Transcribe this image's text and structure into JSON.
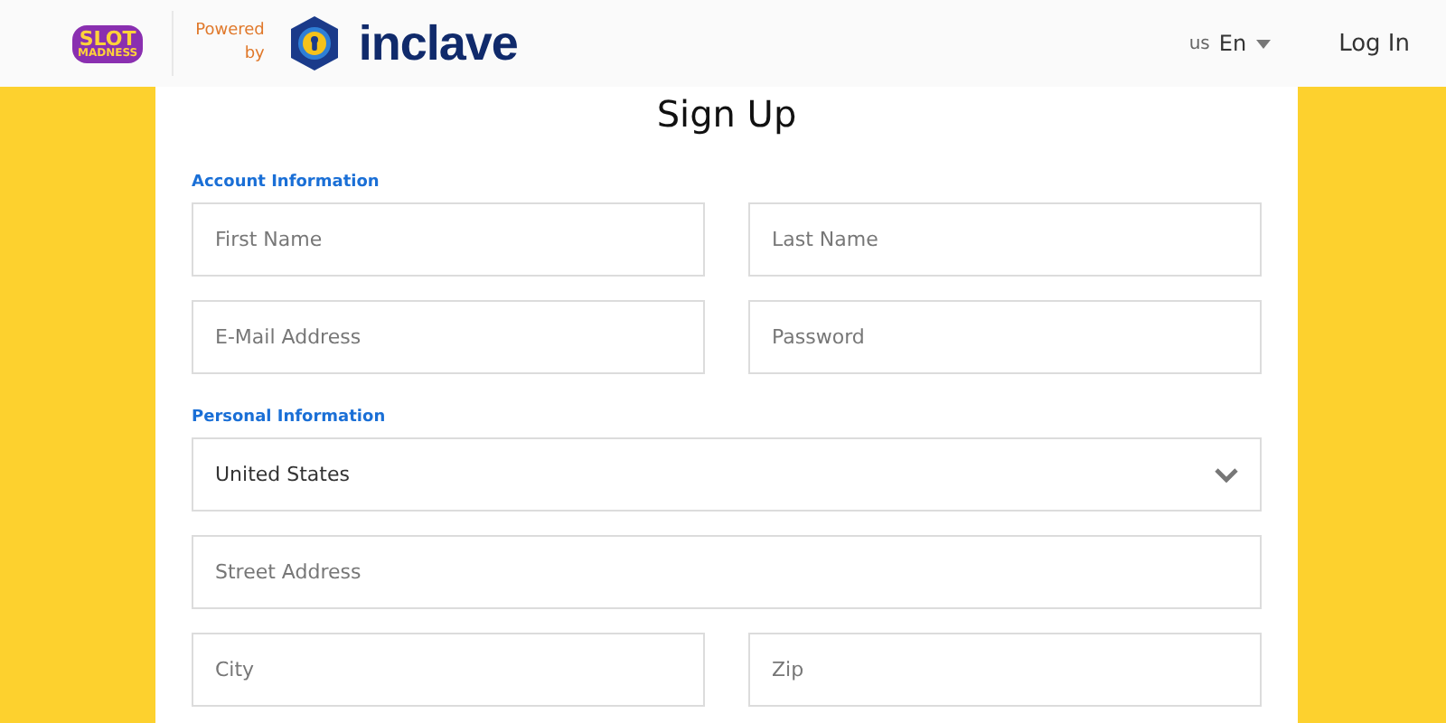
{
  "header": {
    "logo": {
      "line_1": "SLOT",
      "line_2": "MADNESS"
    },
    "powered_by": {
      "line_1": "Powered",
      "line_2": "by"
    },
    "brand": "inclave",
    "language": {
      "country": "us",
      "code": "En"
    },
    "login": "Log In"
  },
  "form": {
    "title": "Sign Up",
    "sections": [
      {
        "heading": "Account Information",
        "rows": [
          [
            {
              "kind": "text",
              "placeholder": "First Name"
            },
            {
              "kind": "text",
              "placeholder": "Last Name"
            }
          ],
          [
            {
              "kind": "text",
              "placeholder": "E-Mail Address"
            },
            {
              "kind": "password",
              "placeholder": "Password"
            }
          ]
        ]
      },
      {
        "heading": "Personal Information",
        "rows": [
          [
            {
              "kind": "select",
              "value": "United States"
            }
          ],
          [
            {
              "kind": "text",
              "placeholder": "Street Address"
            }
          ],
          [
            {
              "kind": "text",
              "placeholder": "City"
            },
            {
              "kind": "text",
              "placeholder": "Zip"
            }
          ]
        ]
      }
    ]
  }
}
